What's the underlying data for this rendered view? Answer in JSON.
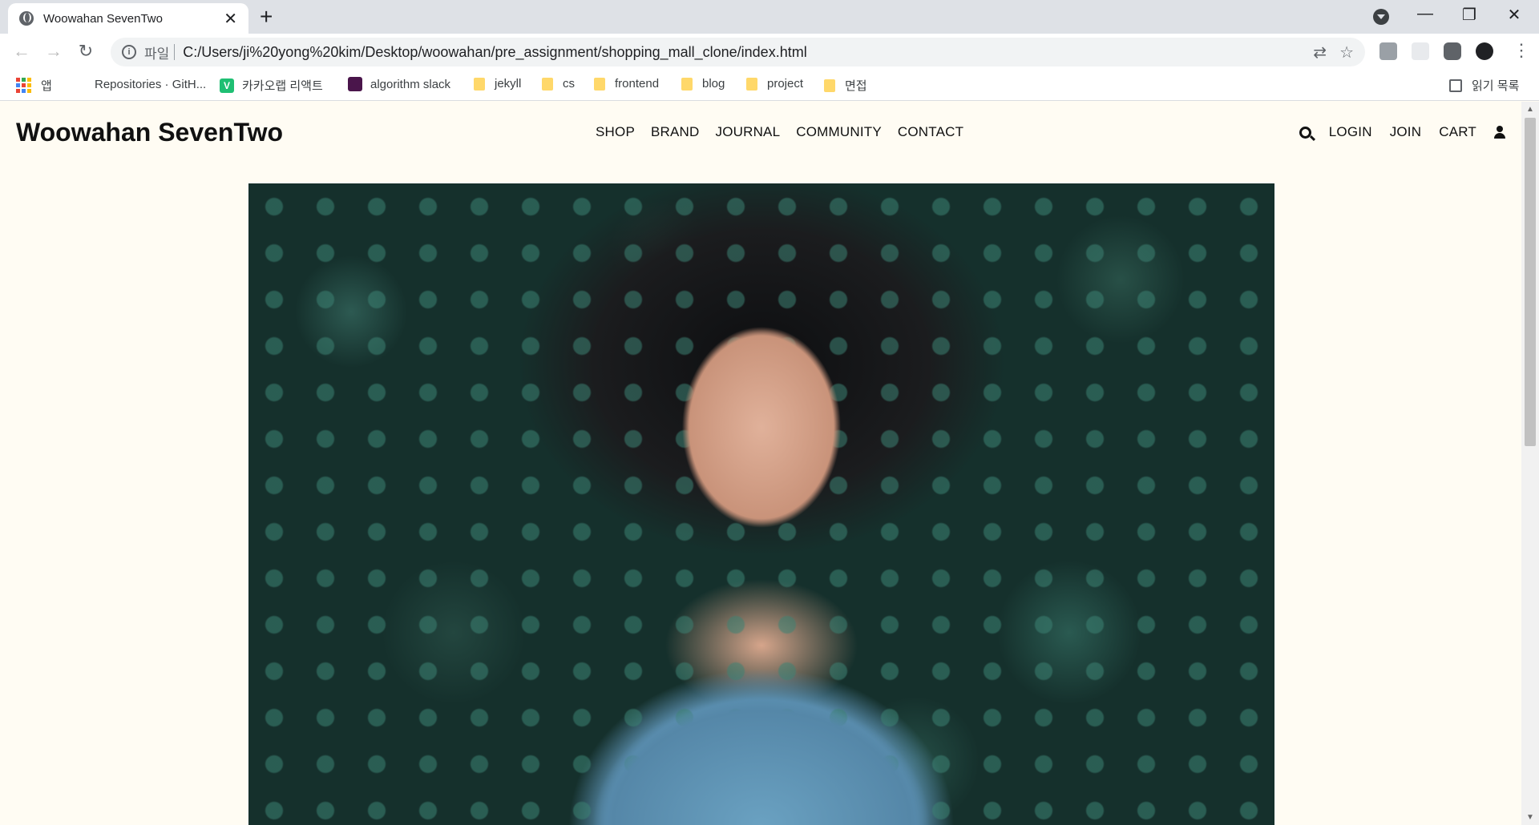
{
  "browser": {
    "tab_title": "Woowahan SevenTwo",
    "new_tab": "+",
    "close": "✕",
    "scheme_label": "파일",
    "url": "C:/Users/ji%20yong%20kim/Desktop/woowahan/pre_assignment/shopping_mall_clone/index.html",
    "window_controls": [
      "—",
      "❐",
      "✕"
    ]
  },
  "bookmarks": [
    {
      "label": "앱",
      "icon": "apps-grid-icon"
    },
    {
      "label": "Repositories · GitH...",
      "icon": "github-icon"
    },
    {
      "label": "카카오랩 리액트",
      "icon": "v-badge-icon",
      "badge": "V",
      "color": "#1fbf73"
    },
    {
      "label": "algorithm slack",
      "icon": "slack-icon",
      "color": "#4a154b"
    },
    {
      "label": "jekyll",
      "icon": "folder-icon"
    },
    {
      "label": "cs",
      "icon": "folder-icon"
    },
    {
      "label": "frontend",
      "icon": "folder-icon"
    },
    {
      "label": "blog",
      "icon": "folder-icon"
    },
    {
      "label": "project",
      "icon": "folder-icon"
    },
    {
      "label": "면접",
      "icon": "folder-icon"
    }
  ],
  "reading_list": "읽기 목록",
  "site": {
    "logo": "Woowahan SevenTwo",
    "nav": [
      "SHOP",
      "BRAND",
      "JOURNAL",
      "COMMUNITY",
      "CONTACT"
    ],
    "user_nav": [
      "LOGIN",
      "JOIN",
      "CART"
    ]
  },
  "colors": {
    "page_background": "#fffcf3",
    "chrome_background": "#dee1e6"
  }
}
